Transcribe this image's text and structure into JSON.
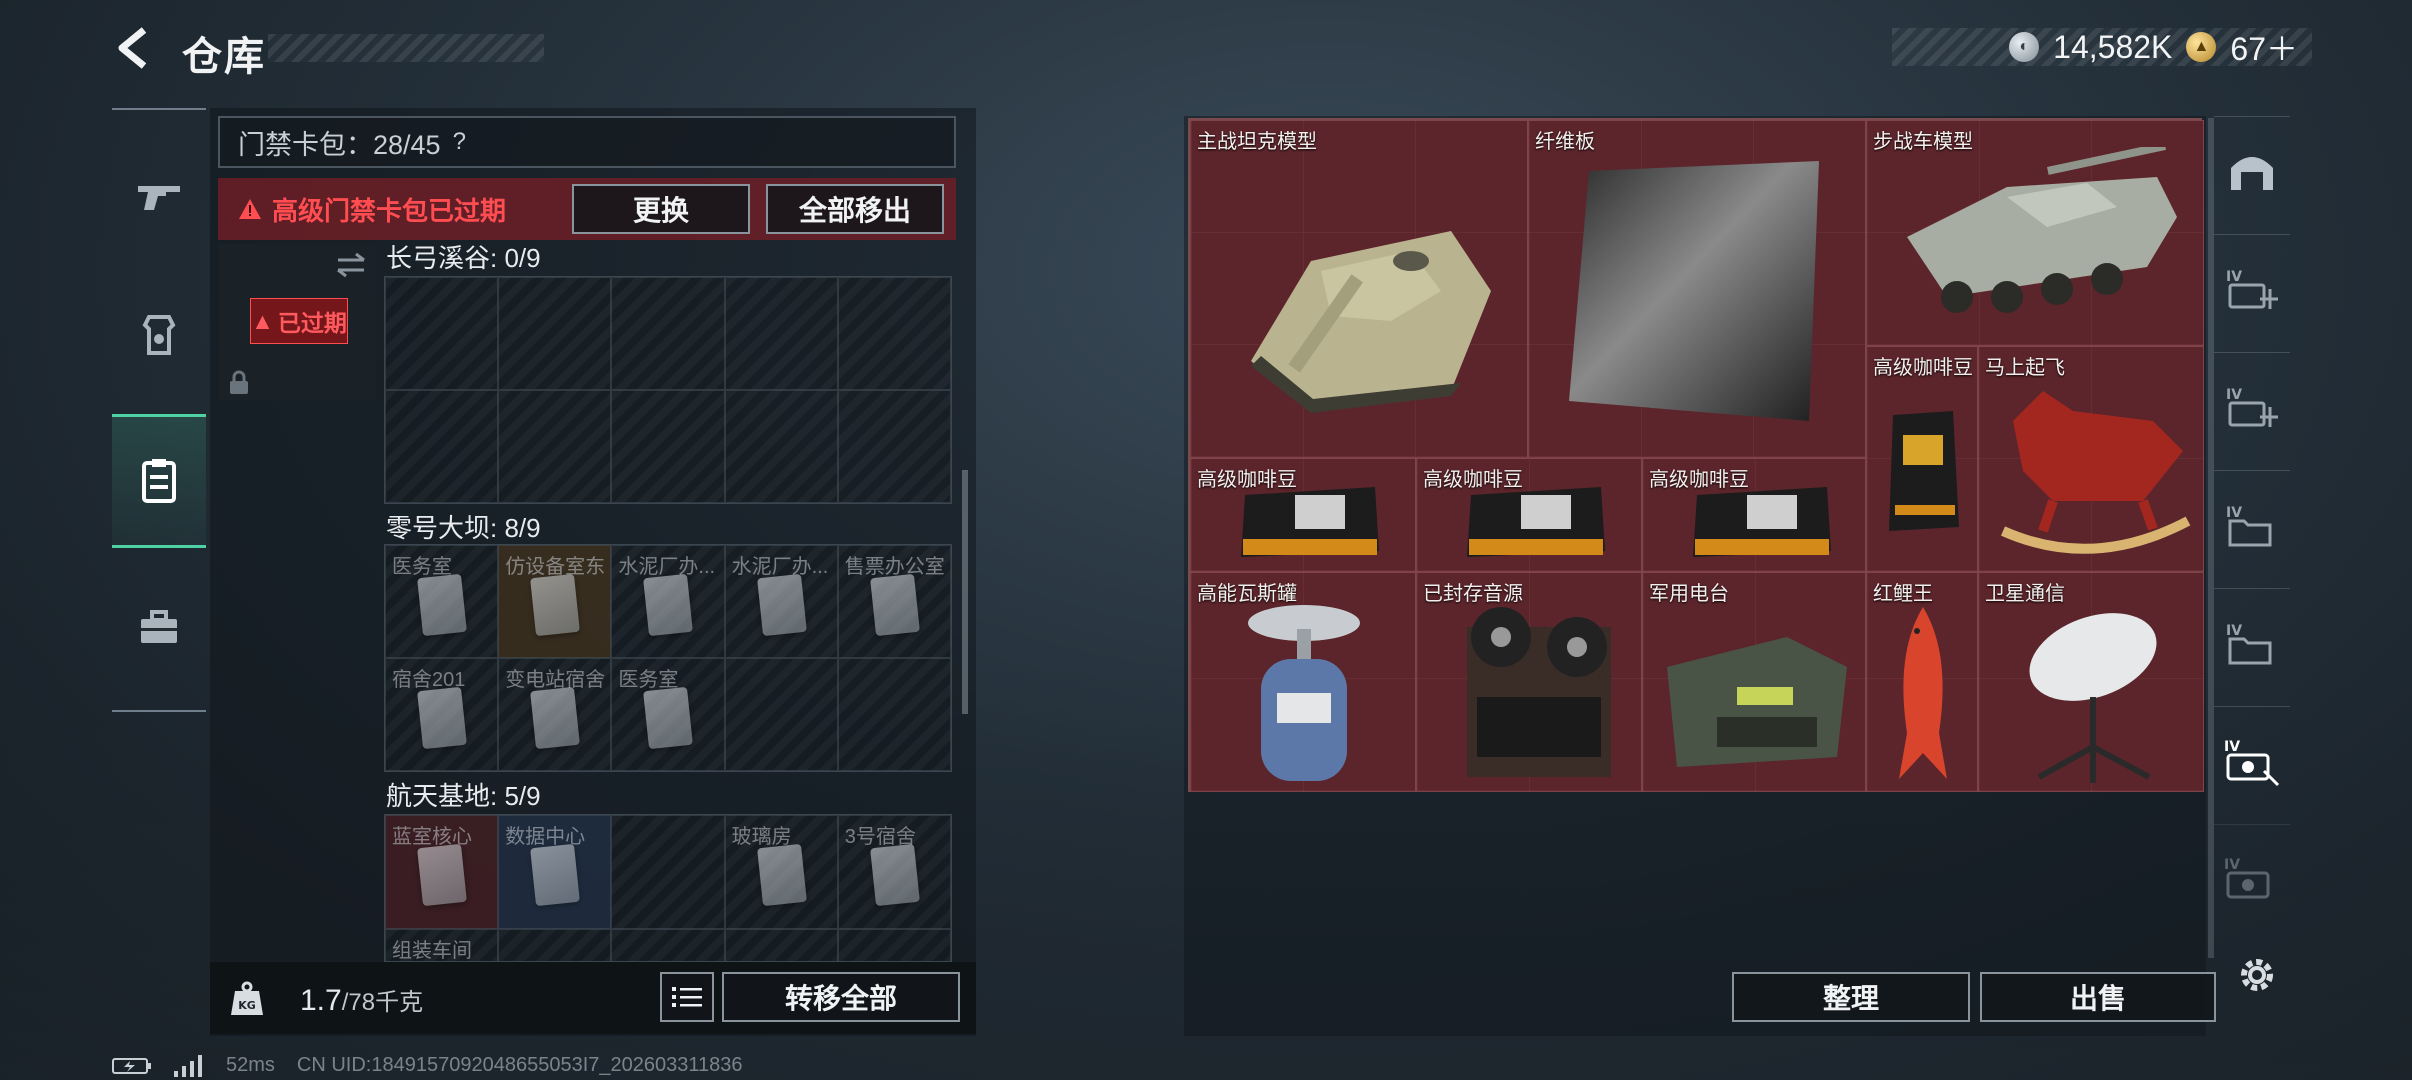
{
  "header": {
    "title": "仓库"
  },
  "currency": {
    "silver": "14,582K",
    "gold": "67＋"
  },
  "keypack": {
    "label": "门禁卡包：28/45",
    "help": "?",
    "expired_warning": "高级门禁卡包已过期",
    "replace_button": "更换",
    "remove_all_button": "全部移出",
    "expired_badge": "已过期"
  },
  "sections": [
    {
      "title": "长弓溪谷: 0/9",
      "cells": [
        "",
        "",
        "",
        "",
        "",
        "",
        "",
        "",
        "",
        ""
      ]
    },
    {
      "title": "零号大坝: 8/9",
      "cells": [
        "医务室",
        "仿设备室东",
        "水泥厂办...",
        "水泥厂办...",
        "售票办公室",
        "宿舍201",
        "变电站宿舍",
        "医务室",
        "",
        ""
      ]
    },
    {
      "title": "航天基地: 5/9",
      "cells": [
        "蓝室核心",
        "数据中心",
        "",
        "玻璃房",
        "3号宿舍",
        "组装车间"
      ]
    }
  ],
  "weight": {
    "current": "1.7",
    "max": "/78千克"
  },
  "transfer_all_button": "转移全部",
  "storage": {
    "items": [
      {
        "name": "主战坦克模型"
      },
      {
        "name": "纤维板"
      },
      {
        "name": "步战车模型"
      },
      {
        "name": "高级咖啡豆"
      },
      {
        "name": "马上起飞"
      },
      {
        "name": "高级咖啡豆"
      },
      {
        "name": "高级咖啡豆"
      },
      {
        "name": "高级咖啡豆"
      },
      {
        "name": "高能瓦斯罐"
      },
      {
        "name": "已封存音源"
      },
      {
        "name": "军用电台"
      },
      {
        "name": "红鲤王"
      },
      {
        "name": "卫星通信"
      }
    ]
  },
  "actions": {
    "organize": "整理",
    "sell": "出售"
  },
  "status": {
    "ping": "52ms",
    "uid": "CN UID:1849157092048655053I7_202603311836"
  },
  "colors": {
    "accent": "#4fd1a5",
    "warning": "#ff4d52",
    "storage_bg": "#5a2429"
  }
}
